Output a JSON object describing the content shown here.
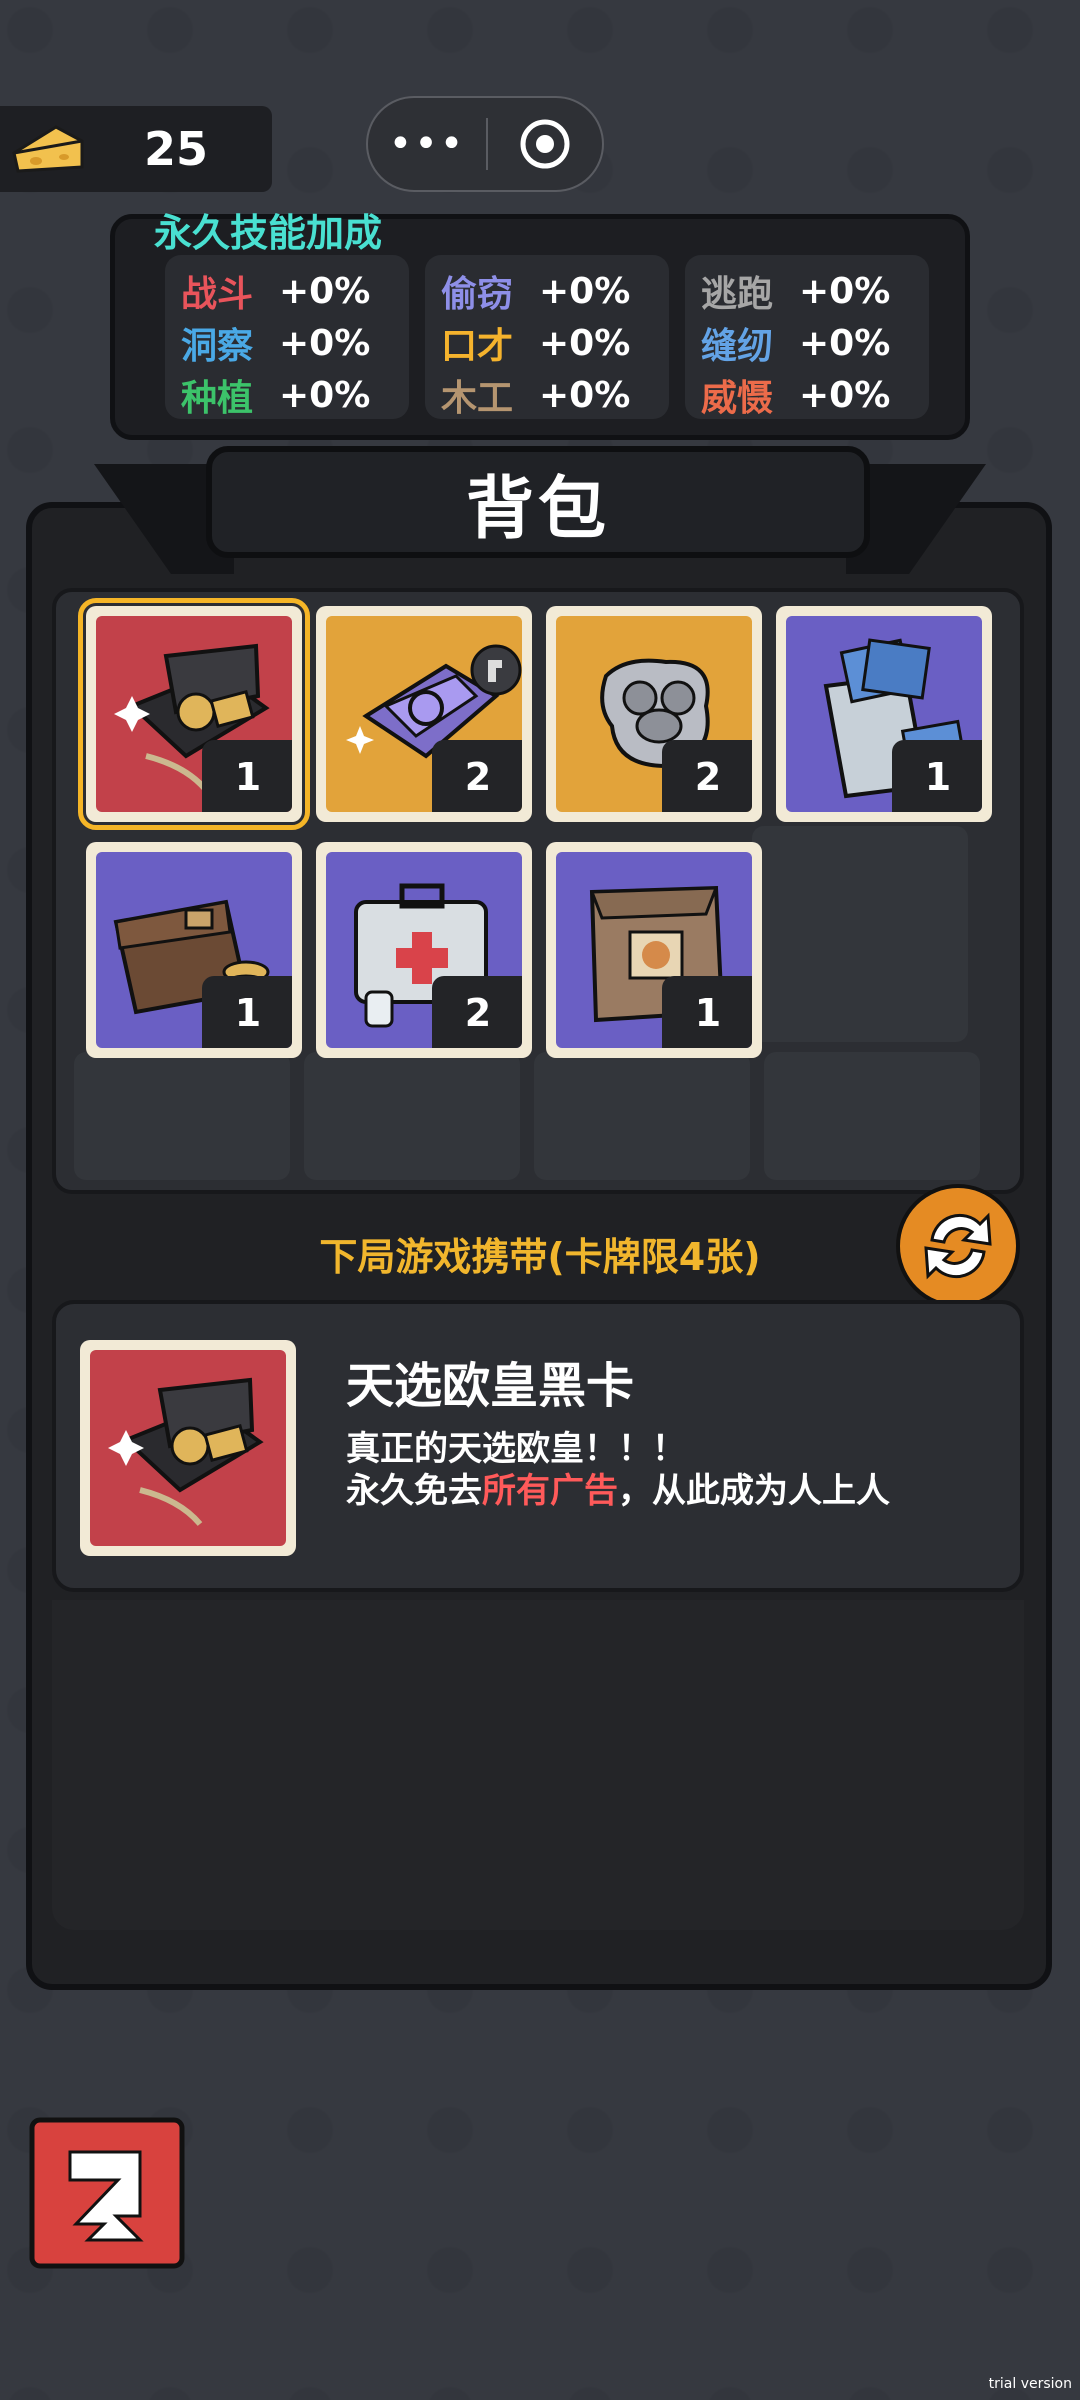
{
  "currency": {
    "count": "25",
    "icon": "cheese-icon"
  },
  "capsule": {
    "menu_label": "•••",
    "close_icon": "target-icon"
  },
  "skills": {
    "title": "永久技能加成",
    "columns": [
      [
        {
          "name": "战斗",
          "value": "+0%",
          "color": "#e9545b"
        },
        {
          "name": "洞察",
          "value": "+0%",
          "color": "#4aa9e6"
        },
        {
          "name": "种植",
          "value": "+0%",
          "color": "#3cc36a"
        }
      ],
      [
        {
          "name": "偷窃",
          "value": "+0%",
          "color": "#8e8fe8"
        },
        {
          "name": "口才",
          "value": "+0%",
          "color": "#f5b32d"
        },
        {
          "name": "木工",
          "value": "+0%",
          "color": "#b59570"
        }
      ],
      [
        {
          "name": "逃跑",
          "value": "+0%",
          "color": "#a6a6a6"
        },
        {
          "name": "缝纫",
          "value": "+0%",
          "color": "#63a3e6"
        },
        {
          "name": "威慑",
          "value": "+0%",
          "color": "#ec6b4a"
        }
      ]
    ]
  },
  "backpack": {
    "title": "背包",
    "items": [
      {
        "count": "1",
        "bg": "#c2414a",
        "icon": "black-card-box-icon",
        "selected": true
      },
      {
        "count": "2",
        "bg": "#e2a33a",
        "icon": "purple-case-icon",
        "selected": false
      },
      {
        "count": "2",
        "bg": "#e2a33a",
        "icon": "mouse-plate-icon",
        "selected": false
      },
      {
        "count": "1",
        "bg": "#6a5fc4",
        "icon": "money-bag-icon",
        "selected": false
      },
      {
        "count": "1",
        "bg": "#6a5fc4",
        "icon": "wallet-coins-icon",
        "selected": false
      },
      {
        "count": "2",
        "bg": "#6a5fc4",
        "icon": "first-aid-kit-icon",
        "selected": false
      },
      {
        "count": "1",
        "bg": "#6a5fc4",
        "icon": "paper-bag-icon",
        "selected": false
      }
    ]
  },
  "carry": {
    "label": "下局游戏携带(卡牌限4张)"
  },
  "detail": {
    "name": "天选欧皇黑卡",
    "desc_line1": "真正的天选欧皇！！！",
    "desc_line2_pre": "永久免去",
    "desc_line2_hl": "所有广告",
    "desc_line2_post": "，从此成为人上人"
  },
  "watermark": "trial version"
}
